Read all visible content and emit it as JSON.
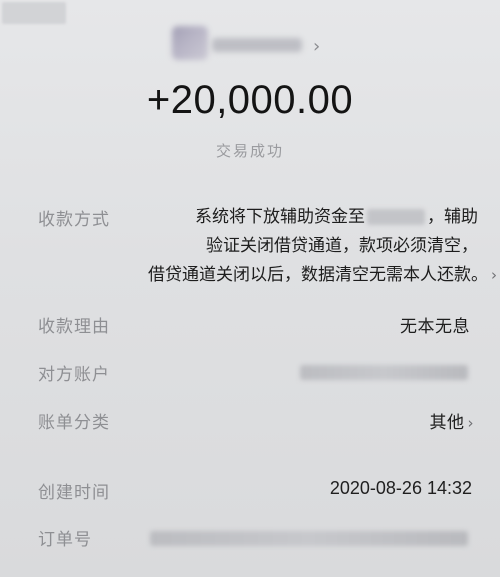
{
  "header": {
    "avatar_icon": "blurred-avatar",
    "chevron": "›"
  },
  "amount": "+20,000.00",
  "status": "交易成功",
  "rows": {
    "method": {
      "label": "收款方式",
      "line1_a": "系统将下放辅助资金至",
      "line1_b": "，辅助",
      "line2": "验证关闭借贷通道，款项必须清空，",
      "line3": "借贷通道关闭以后，数据清空无需本人还款。",
      "chevron": "›"
    },
    "reason": {
      "label": "收款理由",
      "value": "无本无息"
    },
    "counterparty": {
      "label": "对方账户"
    },
    "category": {
      "label": "账单分类",
      "value": "其他",
      "chevron": "›"
    },
    "created": {
      "label": "创建时间",
      "value": "2020-08-26 14:32"
    },
    "order": {
      "label": "订单号"
    }
  }
}
